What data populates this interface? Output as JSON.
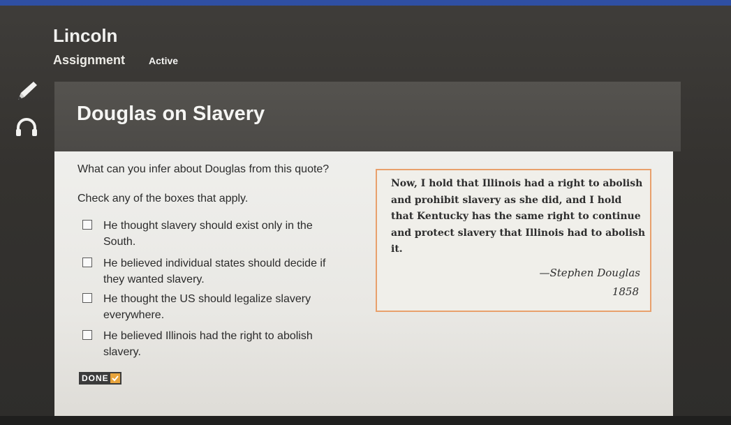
{
  "header": {
    "app_title": "Lincoln",
    "section_label": "Assignment",
    "status_label": "Active"
  },
  "tools": [
    {
      "icon": "pencil-icon"
    },
    {
      "icon": "headphones-icon"
    }
  ],
  "card": {
    "title": "Douglas on Slavery",
    "question": "What can you infer about Douglas from this quote?",
    "instruction": "Check any of the boxes that apply.",
    "options": [
      {
        "label": "He thought slavery should exist only in the South.",
        "checked": false
      },
      {
        "label": "He believed individual states should decide if they wanted slavery.",
        "checked": false
      },
      {
        "label": "He thought the US should legalize slavery everywhere.",
        "checked": false
      },
      {
        "label": "He believed Illinois had the right to abolish slavery.",
        "checked": false
      }
    ],
    "quote": {
      "text": "Now, I hold that Illinois had a right to abolish and prohibit slavery as she did, and I hold that Kentucky has the same right to continue and protect slavery that Illinois had to abolish it.",
      "author": "—Stephen Douglas",
      "year": "1858"
    },
    "done_label": "DONE",
    "accent_color": "#e8a06c"
  }
}
